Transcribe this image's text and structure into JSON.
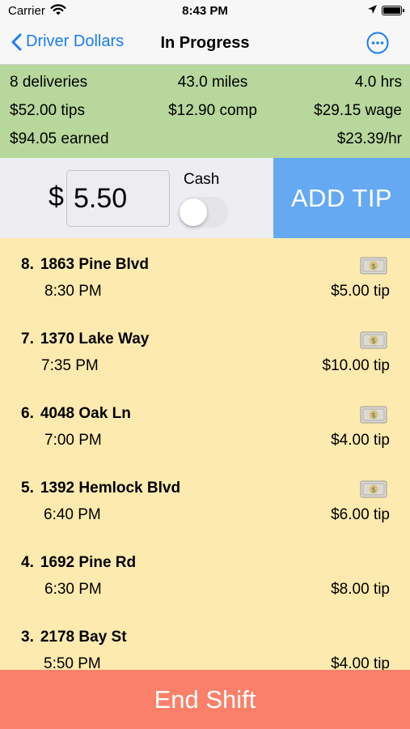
{
  "status_bar": {
    "carrier": "Carrier",
    "time": "8:43 PM"
  },
  "nav": {
    "back_label": "Driver Dollars",
    "title": "In Progress"
  },
  "summary": {
    "deliveries": "8 deliveries",
    "miles": "43.0 miles",
    "hours": "4.0 hrs",
    "tips": "$52.00 tips",
    "comp": "$12.90 comp",
    "wage": "$29.15 wage",
    "earned": "$94.05 earned",
    "hourly": "$23.39/hr"
  },
  "tip_entry": {
    "currency": "$",
    "amount": "5.50",
    "cash_label": "Cash",
    "cash_on": false,
    "add_label": "ADD TIP"
  },
  "deliveries": [
    {
      "number": "8.",
      "address": "1863 Pine Blvd",
      "time": "8:30 PM",
      "tip": "$5.00 tip",
      "cash_icon": "cash-icon"
    },
    {
      "number": "7.",
      "address": "1370 Lake Way",
      "time": "7:35 PM",
      "tip": "$10.00 tip",
      "cash_icon": "cash-icon"
    },
    {
      "number": "6.",
      "address": "4048 Oak Ln",
      "time": "7:00 PM",
      "tip": "$4.00 tip",
      "cash_icon": "cash-icon"
    },
    {
      "number": "5.",
      "address": "1392 Hemlock Blvd",
      "time": "6:40 PM",
      "tip": "$6.00 tip",
      "cash_icon": "cash-icon"
    },
    {
      "number": "4.",
      "address": "1692 Pine Rd",
      "time": "6:30 PM",
      "tip": "$8.00 tip",
      "cash_icon": ""
    },
    {
      "number": "3.",
      "address": "2178 Bay St",
      "time": "5:50 PM",
      "tip": "$4.00 tip",
      "cash_icon": ""
    }
  ],
  "end_shift_label": "End Shift",
  "colors": {
    "accent": "#1a7cf5",
    "summary_bg": "#b7d79c",
    "list_bg": "#fdeaae",
    "add_tip_bg": "#66a9f3",
    "end_shift_bg": "#fb806a"
  }
}
